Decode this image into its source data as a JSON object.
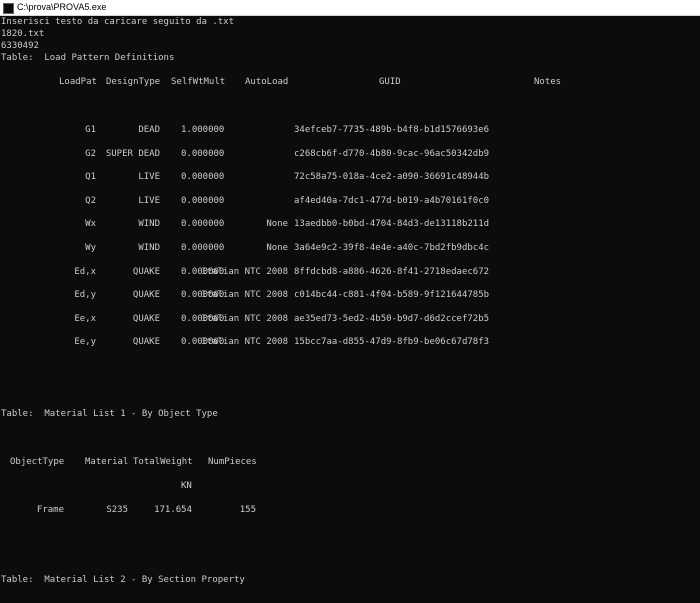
{
  "window": {
    "title": "C:\\prova\\PROVA5.exe",
    "icon": "console-app-icon"
  },
  "console": {
    "prompt_line": "Inserisci testo da caricare seguito da .txt",
    "input_file": "1820.txt",
    "number": "6330492",
    "table1": {
      "title": "Table:  Load Pattern Definitions",
      "headers": {
        "loadpat": "LoadPat",
        "designtype": "DesignType",
        "selfwt": "SelfWtMult",
        "autoload": "AutoLoad",
        "guid": "GUID",
        "notes": "Notes"
      },
      "rows": [
        {
          "loadpat": "G1",
          "designtype": "DEAD",
          "selfwt": "1.000000",
          "autoload": "",
          "guid": "34efceb7-7735-489b-b4f8-b1d1576693e6"
        },
        {
          "loadpat": "G2",
          "designtype": "SUPER DEAD",
          "selfwt": "0.000000",
          "autoload": "",
          "guid": "c268cb6f-d770-4b80-9cac-96ac50342db9"
        },
        {
          "loadpat": "Q1",
          "designtype": "LIVE",
          "selfwt": "0.000000",
          "autoload": "",
          "guid": "72c58a75-018a-4ce2-a090-36691c48944b"
        },
        {
          "loadpat": "Q2",
          "designtype": "LIVE",
          "selfwt": "0.000000",
          "autoload": "",
          "guid": "af4ed40a-7dc1-477d-b019-a4b70161f0c0"
        },
        {
          "loadpat": "Wx",
          "designtype": "WIND",
          "selfwt": "0.000000",
          "autoload": "None",
          "guid": "13aedbb0-b0bd-4704-84d3-de13118b211d"
        },
        {
          "loadpat": "Wy",
          "designtype": "WIND",
          "selfwt": "0.000000",
          "autoload": "None",
          "guid": "3a64e9c2-39f8-4e4e-a40c-7bd2fb9dbc4c"
        },
        {
          "loadpat": "Ed,x",
          "designtype": "QUAKE",
          "selfwt": "0.000000",
          "autoload": "Italian NTC 2008",
          "guid": "8ffdcbd8-a886-4626-8f41-2718edaec672"
        },
        {
          "loadpat": "Ed,y",
          "designtype": "QUAKE",
          "selfwt": "0.000000",
          "autoload": "Italian NTC 2008",
          "guid": "c014bc44-c881-4f04-b589-9f121644785b"
        },
        {
          "loadpat": "Ee,x",
          "designtype": "QUAKE",
          "selfwt": "0.000000",
          "autoload": "Italian NTC 2008",
          "guid": "ae35ed73-5ed2-4b50-b9d7-d6d2ccef72b5"
        },
        {
          "loadpat": "Ee,y",
          "designtype": "QUAKE",
          "selfwt": "0.000000",
          "autoload": "Italian NTC 2008",
          "guid": "15bcc7aa-d855-47d9-8fb9-be06c67d78f3"
        }
      ]
    },
    "table2": {
      "title": "Table:  Material List 1 - By Object Type",
      "headers": {
        "objecttype": "ObjectType",
        "material": "Material",
        "totalweight": "TotalWeight",
        "numpieces": "NumPieces"
      },
      "units": {
        "totalweight": "KN"
      },
      "rows": [
        {
          "objecttype": "Frame",
          "material": "S235",
          "totalweight": "171.654",
          "numpieces": "155"
        }
      ]
    },
    "table3": {
      "title": "Table:  Material List 2 - By Section Property"
    }
  },
  "colors": {
    "background": "#0c0c0c",
    "text": "#cccccc",
    "titlebar": "#ffffff"
  }
}
